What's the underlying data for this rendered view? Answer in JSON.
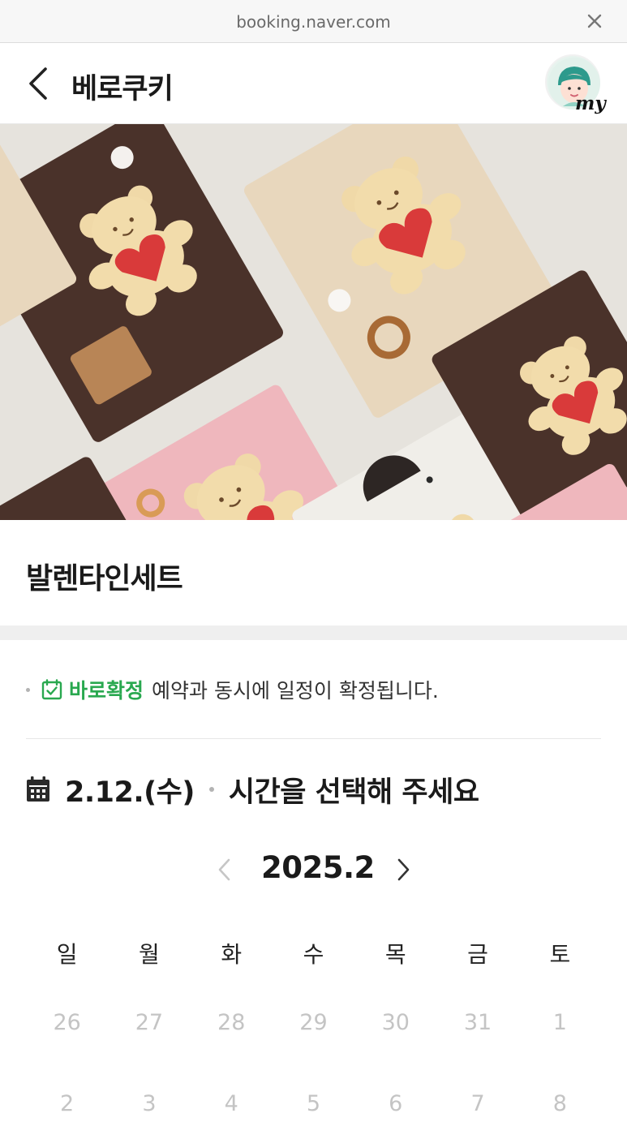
{
  "browser": {
    "url": "booking.naver.com"
  },
  "header": {
    "title": "베로쿠키",
    "my_label": "my"
  },
  "product": {
    "name": "발렌타인세트"
  },
  "notice": {
    "badge": "바로확정",
    "text": "예약과 동시에 일정이 확정됩니다."
  },
  "selection": {
    "date": "2.12.(수)",
    "prompt": "시간을 선택해 주세요"
  },
  "calendar": {
    "month_label": "2025.2",
    "weekdays": [
      "일",
      "월",
      "화",
      "수",
      "목",
      "금",
      "토"
    ],
    "weeks": [
      [
        "26",
        "27",
        "28",
        "29",
        "30",
        "31",
        "1"
      ],
      [
        "2",
        "3",
        "4",
        "5",
        "6",
        "7",
        "8"
      ]
    ]
  },
  "colors": {
    "accent_green": "#29a84f",
    "disabled_text": "#c4c4c4"
  }
}
